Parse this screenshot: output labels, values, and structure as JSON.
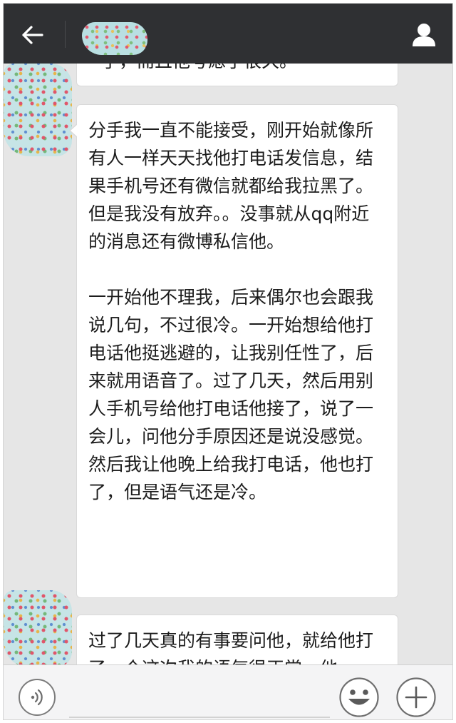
{
  "header": {
    "back_icon": "arrow-left-icon",
    "title_obscured": true,
    "profile_icon": "person-icon"
  },
  "messages": [
    {
      "sender": "contact",
      "text": "了，而且他考虑了很久。"
    },
    {
      "sender": "contact",
      "paragraphs": [
        "分手我一直不能接受，刚开始就像所有人一样天天找他打电话发信息，结果手机号还有微信就都给我拉黑了。但是我没有放弃。。没事就从qq附近的消息还有微博私信他。",
        "一开始他不理我，后来偶尔也会跟我说几句，不过很冷。一开始想给他打电话他挺逃避的，让我别任性了，后来就用语音了。过了几天，然后用别人手机号给他打电话他接了，说了一会儿，问他分手原因还是说没感觉。然后我让他晚上给我打电话，他也打了，但是语气还是冷。"
      ]
    },
    {
      "sender": "contact",
      "text": "过了几天真的有事要问他，就给他打了一个这次我的语气很正常，他"
    }
  ],
  "input_bar": {
    "voice_icon": "voice-icon",
    "input_value": "",
    "input_placeholder": "",
    "emoji_icon": "smiley-icon",
    "more_icon": "plus-icon"
  },
  "colors": {
    "topbar_bg": "#2f3033",
    "chat_bg": "#e6e6e6",
    "bubble_bg": "#ffffff",
    "bottombar_bg": "#f4f4f5"
  }
}
